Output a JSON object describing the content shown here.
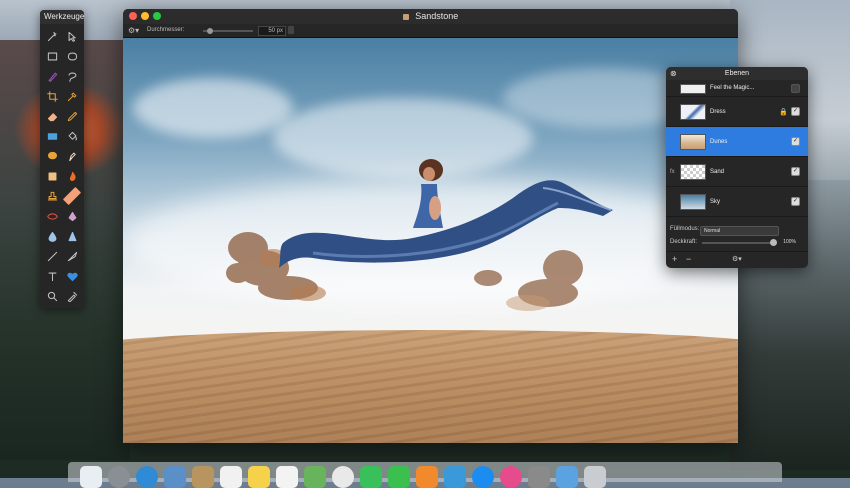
{
  "palette": {
    "title": "Werkzeuge",
    "tools": [
      {
        "icon": "magic-wand-icon",
        "color": "#c0c0c0"
      },
      {
        "icon": "move-arrow-icon",
        "color": "#c0c0c0"
      },
      {
        "icon": "rect-select-icon",
        "color": "#c0c0c0"
      },
      {
        "icon": "ellipse-select-icon",
        "color": "#c0c0c0"
      },
      {
        "icon": "brush-purple-icon",
        "color": "#9b59b6"
      },
      {
        "icon": "lasso-icon",
        "color": "#c0c0c0"
      },
      {
        "icon": "crop-icon",
        "color": "#e7a33a"
      },
      {
        "icon": "eyedropper-icon",
        "color": "#e7a33a"
      },
      {
        "icon": "eraser-icon",
        "color": "#f0b28a"
      },
      {
        "icon": "pencil-icon",
        "color": "#e7a33a"
      },
      {
        "icon": "fill-rect-icon",
        "color": "#4aa3df"
      },
      {
        "icon": "bucket-icon",
        "color": "#c0c0c0"
      },
      {
        "icon": "paint-icon",
        "color": "#e7a33a"
      },
      {
        "icon": "smudge-icon",
        "color": "#f0e0c0"
      },
      {
        "icon": "sponge-icon",
        "color": "#f0c080"
      },
      {
        "icon": "burn-icon",
        "color": "#e76f2a"
      },
      {
        "icon": "stamp-icon",
        "color": "#e7a33a"
      },
      {
        "icon": "bandage-icon",
        "color": "#f2a27a"
      },
      {
        "icon": "eye-icon",
        "color": "#e74c3c"
      },
      {
        "icon": "blur-icon",
        "color": "#d0a0d0"
      },
      {
        "icon": "drop-icon",
        "color": "#9fc4e8"
      },
      {
        "icon": "cone-icon",
        "color": "#9fc4e8"
      },
      {
        "icon": "line-icon",
        "color": "#c0c0c0"
      },
      {
        "icon": "pen-icon",
        "color": "#c0c0c0"
      },
      {
        "icon": "text-icon",
        "color": "#c0c0c0"
      },
      {
        "icon": "heart-icon",
        "color": "#3a8fe0"
      },
      {
        "icon": "zoom-icon",
        "color": "#c0c0c0"
      },
      {
        "icon": "color-picker-icon",
        "color": "#c0c0c0"
      }
    ]
  },
  "window": {
    "title": "Sandstone",
    "toolbar": {
      "diameter_label": "Durchmesser:",
      "diameter_value": "50 px"
    }
  },
  "layers_panel": {
    "title": "Ebenen",
    "layers": [
      {
        "name": "Feel the Magic...",
        "visible": false,
        "locked": false,
        "fx": false,
        "selected": false
      },
      {
        "name": "Dress",
        "visible": true,
        "locked": true,
        "fx": false,
        "selected": false
      },
      {
        "name": "Dunes",
        "visible": true,
        "locked": false,
        "fx": false,
        "selected": true
      },
      {
        "name": "Sand",
        "visible": true,
        "locked": false,
        "fx": true,
        "selected": false
      },
      {
        "name": "Sky",
        "visible": true,
        "locked": false,
        "fx": false,
        "selected": false
      }
    ],
    "fx_label": "fx",
    "blend_label": "Füllmodus:",
    "blend_value": "Normal",
    "opacity_label": "Deckkraft:",
    "opacity_value": "100%",
    "add_label": "+",
    "remove_label": "−",
    "gear_label": "⚙▾"
  },
  "colors": {
    "selected_layer": "#2f7ce0",
    "close": "#ff5f57",
    "minimize": "#febc2e",
    "zoom": "#28c840"
  },
  "dock": {
    "icons": [
      "finder-icon",
      "launchpad-icon",
      "safari-icon",
      "preview-icon",
      "contacts-icon",
      "calendar-icon",
      "notes-icon",
      "reminders-icon",
      "maps-icon",
      "photos-icon",
      "messages-icon",
      "facetime-icon",
      "books-icon",
      "pixelmator-icon",
      "app-store-icon",
      "itunes-icon",
      "system-preferences-icon",
      "downloads-icon",
      "trash-icon"
    ]
  }
}
